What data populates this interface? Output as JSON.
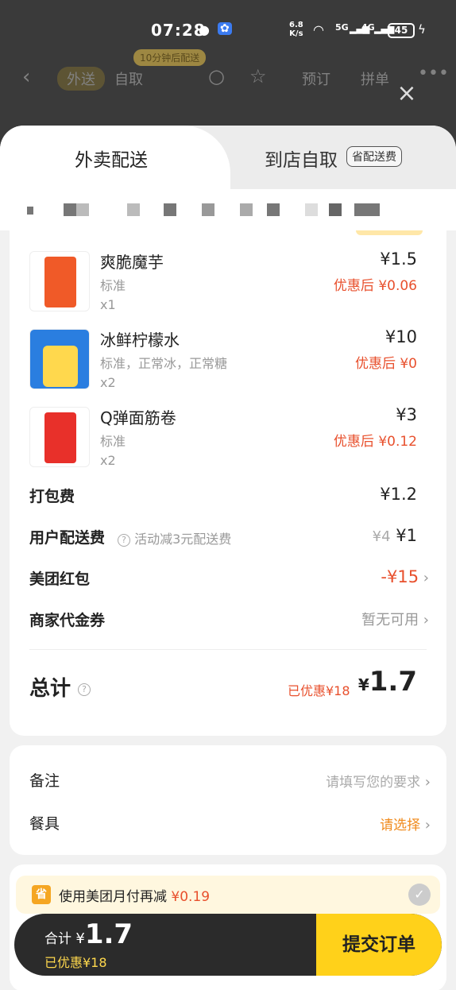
{
  "status_bar": {
    "time": "07:28",
    "net_speed_top": "6.8",
    "net_speed_bottom": "K/s",
    "sig1": "5G",
    "sig2": "4G",
    "battery": "45"
  },
  "background_nav": {
    "promo": "10分钟后配送",
    "tab_delivery": "外送",
    "tab_pickup": "自取",
    "preorder": "预订",
    "group": "拼单"
  },
  "tabs": {
    "delivery": "外卖配送",
    "pickup": "到店自取",
    "pickup_badge": "省配送费"
  },
  "items": [
    {
      "name": "爽脆魔芋",
      "spec": "标准",
      "qty": "x1",
      "price": "¥1.5",
      "discount": "优惠后 ¥0.06"
    },
    {
      "name": "冰鲜柠檬水",
      "spec": "标准，正常冰，正常糖",
      "qty": "x2",
      "price": "¥10",
      "discount": "优惠后 ¥0"
    },
    {
      "name": "Q弹面筋卷",
      "spec": "标准",
      "qty": "x2",
      "price": "¥3",
      "discount": "优惠后 ¥0.12"
    }
  ],
  "fees": {
    "packing_label": "打包费",
    "packing_value": "¥1.2",
    "delivery_label": "用户配送费",
    "delivery_note": "活动减3元配送费",
    "delivery_original": "¥4",
    "delivery_value": "¥1",
    "redpacket_label": "美团红包",
    "redpacket_value": "-¥15",
    "voucher_label": "商家代金券",
    "voucher_value": "暂无可用"
  },
  "total": {
    "label": "总计",
    "saved": "已优惠¥18",
    "yen": "¥",
    "amount": "1.7"
  },
  "extras": {
    "remark_label": "备注",
    "remark_placeholder": "请填写您的要求",
    "utensils_label": "餐具",
    "utensils_value": "请选择"
  },
  "pay_promo": {
    "icon": "省",
    "text": "使用美团月付再减",
    "amount": "¥0.19"
  },
  "bottom": {
    "total_label": "合计",
    "yen": "¥",
    "amount": "1.7",
    "saved": "已优惠¥18",
    "submit": "提交订单"
  },
  "colors": {
    "accent_red": "#e8502d",
    "accent_yellow": "#ffd11a",
    "utensils_orange": "#f08a1c"
  }
}
